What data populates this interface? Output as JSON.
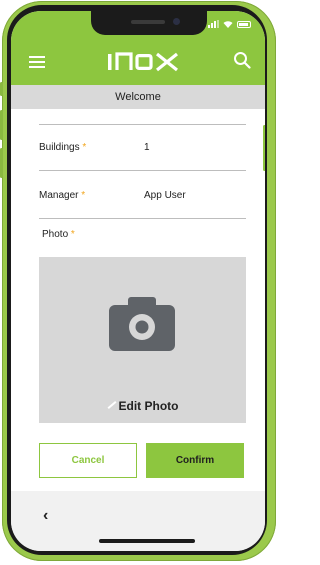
{
  "app": {
    "brand": "INOX",
    "brand_color": "#8dc63f",
    "required_marker_color": "#f1a51d"
  },
  "header": {
    "subtitle": "Welcome",
    "icons": [
      "menu-icon",
      "search-icon"
    ]
  },
  "form": {
    "fields": [
      {
        "label": "Buildings",
        "required_mark": "*",
        "value": "1"
      },
      {
        "label": "Manager",
        "required_mark": "*",
        "value": "App User"
      }
    ],
    "photo": {
      "label": "Photo",
      "required_mark": "*",
      "edit_label": "Edit Photo",
      "icon": "camera-icon"
    }
  },
  "actions": {
    "cancel_label": "Cancel",
    "confirm_label": "Confirm"
  },
  "footer": {
    "back_glyph": "‹"
  }
}
